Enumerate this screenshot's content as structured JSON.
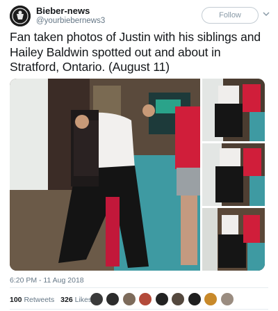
{
  "tweet": {
    "display_name": "Bieber-news",
    "handle": "@yourbiebernews3",
    "follow_label": "Follow",
    "text": "Fan taken photos of Justin with his siblings and Hailey Baldwin spotted out and about in Stratford, Ontario. (August 11)",
    "timestamp": "6:20 PM - 11 Aug 2018",
    "retweets_count": "100",
    "retweets_label": "Retweets",
    "likes_count": "326",
    "likes_label": "Likes"
  },
  "icons": {
    "avatar": "profile-avatar",
    "chevron": "chevron-down-icon"
  },
  "colors": {
    "name": "#14171a",
    "secondary": "#657786",
    "divider": "#e6ecf0"
  }
}
